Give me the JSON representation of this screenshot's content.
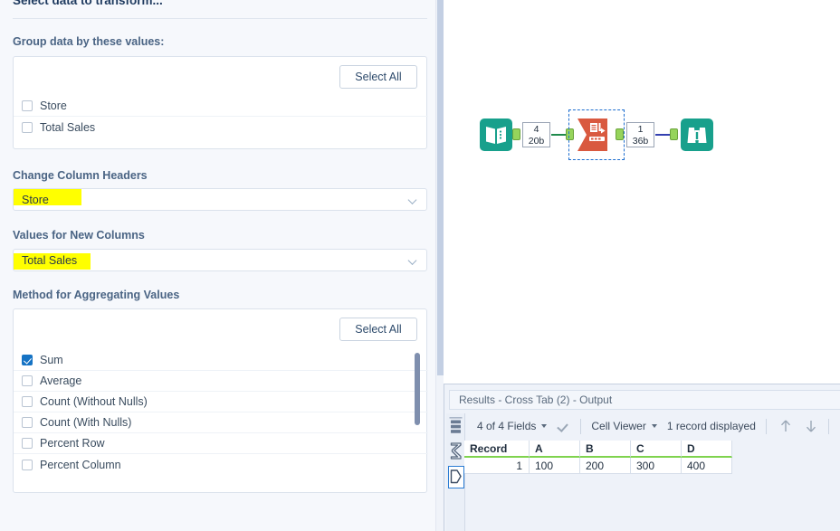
{
  "config_panel": {
    "title": "Select data to transform...",
    "group_section": {
      "label": "Group data by these values:",
      "select_all": "Select All",
      "fields": [
        {
          "label": "Store",
          "checked": false
        },
        {
          "label": "Total Sales",
          "checked": false
        }
      ]
    },
    "change_headers": {
      "label": "Change Column Headers",
      "value": "Store",
      "highlighted": true
    },
    "values_new_columns": {
      "label": "Values for New Columns",
      "value": "Total Sales",
      "highlighted": true
    },
    "aggregation": {
      "label": "Method for Aggregating Values",
      "select_all": "Select All",
      "methods": [
        {
          "label": "Sum",
          "checked": true
        },
        {
          "label": "Average",
          "checked": false
        },
        {
          "label": "Count (Without Nulls)",
          "checked": false
        },
        {
          "label": "Count (With Nulls)",
          "checked": false
        },
        {
          "label": "Percent Row",
          "checked": false
        },
        {
          "label": "Percent Column",
          "checked": false
        }
      ]
    }
  },
  "canvas": {
    "tools": [
      {
        "name": "input-data-tool",
        "icon": "book-icon",
        "color": "#18a08c"
      },
      {
        "name": "cross-tab-tool",
        "icon": "cross-tab-icon",
        "color": "#d9593f",
        "selected": true
      },
      {
        "name": "browse-tool",
        "icon": "binoculars-icon",
        "color": "#18a08c"
      }
    ],
    "connections": [
      {
        "records": "4",
        "size": "20b"
      },
      {
        "records": "1",
        "size": "36b"
      }
    ]
  },
  "results": {
    "title": "Results - Cross Tab (2) - Output",
    "toolbar": {
      "fields": "4 of 4 Fields",
      "viewer": "Cell Viewer",
      "record_count": "1 record displayed"
    },
    "rail_icons": [
      "table-rows-icon",
      "sigma-summary-icon",
      "data-shape-icon"
    ],
    "table": {
      "headers": [
        "Record",
        "A",
        "B",
        "C",
        "D"
      ],
      "rows": [
        [
          "1",
          "100",
          "200",
          "300",
          "400"
        ]
      ]
    }
  },
  "colors": {
    "highlight": "#ffff00",
    "accent_blue": "#1673c4",
    "tool_teal": "#18a08c",
    "tool_orange": "#d9593f",
    "header_underline": "#7fd34e"
  }
}
